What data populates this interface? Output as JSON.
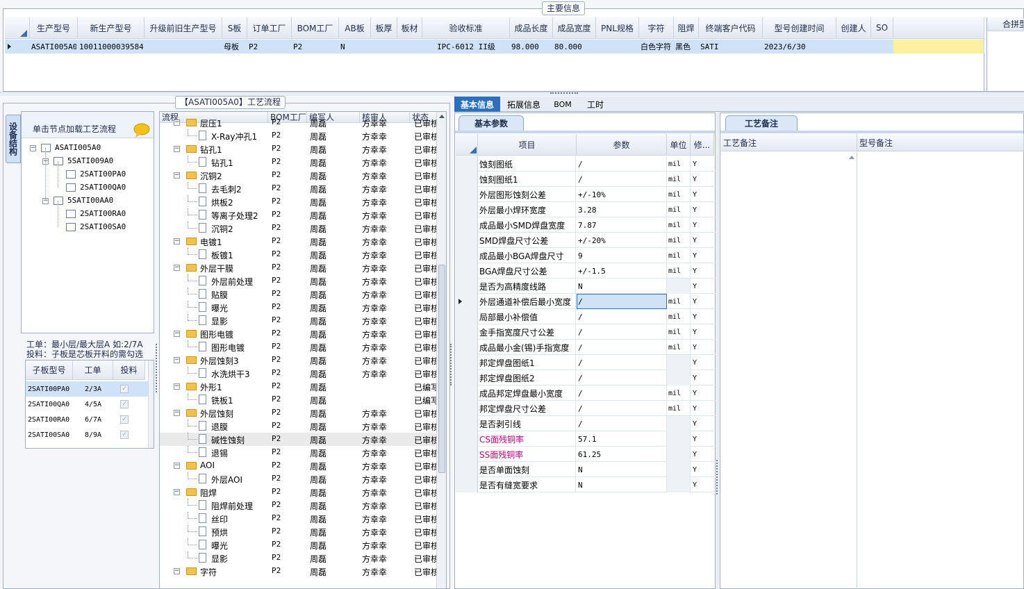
{
  "top": {
    "group_title": "主要信息",
    "columns": [
      "生产型号",
      "新生产型号",
      "升级前旧生产型号",
      "S板",
      "订单工厂",
      "BOM工厂",
      "AB板",
      "板厚",
      "板材",
      "验收标准",
      "成品长度",
      "成品宽度",
      "PNL规格",
      "字符",
      "阻焊",
      "终端客户代码",
      "型号创建时间",
      "创建人",
      "SO"
    ],
    "row": [
      "ASATI005A0",
      "10011000039584",
      "",
      "母板",
      "P2",
      "P2",
      "N",
      "",
      "",
      "IPC-6012 II级",
      "98.000",
      "80.000",
      "",
      "白色字符",
      "黑色",
      "SATI",
      "2023/6/30",
      "",
      ""
    ],
    "right_label": "合拼型"
  },
  "process": {
    "group_title": "【ASATI005A0】工艺流程",
    "side_tab": "设备结构",
    "load_hint": "单击节点加载工艺流程",
    "tree": [
      {
        "label": "ASATI005A0",
        "level": 0
      },
      {
        "label": "5SATI009A0",
        "level": 1
      },
      {
        "label": "2SATI00PA0",
        "level": 2
      },
      {
        "label": "2SATI00QA0",
        "level": 2
      },
      {
        "label": "5SATI00AA0",
        "level": 1
      },
      {
        "label": "2SATI00RA0",
        "level": 2
      },
      {
        "label": "2SATI00SA0",
        "level": 2
      }
    ],
    "note_line1": "工单：最小层/最大层A 如:2/7A",
    "note_line2": "投料：子板是芯板开料的需勾选",
    "sub_headers": [
      "子板型号",
      "工单",
      "投料"
    ],
    "sub_rows": [
      {
        "model": "2SATI00PA0",
        "order": "2/3A"
      },
      {
        "model": "2SATI00QA0",
        "order": "4/5A"
      },
      {
        "model": "2SATI00RA0",
        "order": "6/7A"
      },
      {
        "model": "2SATI00SA0",
        "order": "8/9A"
      }
    ],
    "flow_headers": [
      "流程",
      "BOM工厂",
      "编写人",
      "核审人",
      "状态"
    ],
    "flow_rows": [
      {
        "name": "层压1",
        "level": 0,
        "factory": "P2",
        "writer": "周磊",
        "reviewer": "方幸幸",
        "status": "已审核"
      },
      {
        "name": "X-Ray冲孔1",
        "level": 1,
        "factory": "P2",
        "writer": "周磊",
        "reviewer": "方幸幸",
        "status": "已审核"
      },
      {
        "name": "钻孔1",
        "level": 0,
        "factory": "P2",
        "writer": "周磊",
        "reviewer": "方幸幸",
        "status": "已审核"
      },
      {
        "name": "钻孔1",
        "level": 1,
        "factory": "P2",
        "writer": "周磊",
        "reviewer": "方幸幸",
        "status": "已审核"
      },
      {
        "name": "沉铜2",
        "level": 0,
        "factory": "P2",
        "writer": "周磊",
        "reviewer": "方幸幸",
        "status": "已审核"
      },
      {
        "name": "去毛刺2",
        "level": 1,
        "factory": "P2",
        "writer": "周磊",
        "reviewer": "方幸幸",
        "status": "已审核"
      },
      {
        "name": "烘板2",
        "level": 1,
        "factory": "P2",
        "writer": "周磊",
        "reviewer": "方幸幸",
        "status": "已审核"
      },
      {
        "name": "等离子处理2",
        "level": 1,
        "factory": "P2",
        "writer": "周磊",
        "reviewer": "方幸幸",
        "status": "已审核"
      },
      {
        "name": "沉铜2",
        "level": 1,
        "factory": "P2",
        "writer": "周磊",
        "reviewer": "方幸幸",
        "status": "已审核"
      },
      {
        "name": "电镀1",
        "level": 0,
        "factory": "P2",
        "writer": "周磊",
        "reviewer": "方幸幸",
        "status": "已审核"
      },
      {
        "name": "板镀1",
        "level": 1,
        "factory": "P2",
        "writer": "周磊",
        "reviewer": "方幸幸",
        "status": "已审核"
      },
      {
        "name": "外层干膜",
        "level": 0,
        "factory": "P2",
        "writer": "周磊",
        "reviewer": "方幸幸",
        "status": "已审核"
      },
      {
        "name": "外层前处理",
        "level": 1,
        "factory": "P2",
        "writer": "周磊",
        "reviewer": "方幸幸",
        "status": "已审核"
      },
      {
        "name": "贴膜",
        "level": 1,
        "factory": "P2",
        "writer": "周磊",
        "reviewer": "方幸幸",
        "status": "已审核"
      },
      {
        "name": "曝光",
        "level": 1,
        "factory": "P2",
        "writer": "周磊",
        "reviewer": "方幸幸",
        "status": "已审核"
      },
      {
        "name": "显影",
        "level": 1,
        "factory": "P2",
        "writer": "周磊",
        "reviewer": "方幸幸",
        "status": "已审核"
      },
      {
        "name": "图形电镀",
        "level": 0,
        "factory": "P2",
        "writer": "周磊",
        "reviewer": "方幸幸",
        "status": "已审核"
      },
      {
        "name": "图形电镀",
        "level": 1,
        "factory": "P2",
        "writer": "周磊",
        "reviewer": "方幸幸",
        "status": "已审核"
      },
      {
        "name": "外层蚀刻3",
        "level": 0,
        "factory": "P2",
        "writer": "周磊",
        "reviewer": "方幸幸",
        "status": "已审核"
      },
      {
        "name": "水洗烘干3",
        "level": 1,
        "factory": "P2",
        "writer": "周磊",
        "reviewer": "方幸幸",
        "status": "已审核"
      },
      {
        "name": "外形1",
        "level": 0,
        "factory": "P2",
        "writer": "周磊",
        "reviewer": "",
        "status": "已编写"
      },
      {
        "name": "铣板1",
        "level": 1,
        "factory": "P2",
        "writer": "周磊",
        "reviewer": "",
        "status": "已编写"
      },
      {
        "name": "外层蚀刻",
        "level": 0,
        "factory": "P2",
        "writer": "周磊",
        "reviewer": "方幸幸",
        "status": "已审核"
      },
      {
        "name": "退膜",
        "level": 1,
        "factory": "P2",
        "writer": "周磊",
        "reviewer": "方幸幸",
        "status": "已审核"
      },
      {
        "name": "碱性蚀刻",
        "level": 1,
        "factory": "P2",
        "writer": "周磊",
        "reviewer": "方幸幸",
        "status": "已审核"
      },
      {
        "name": "退锡",
        "level": 1,
        "factory": "P2",
        "writer": "周磊",
        "reviewer": "方幸幸",
        "status": "已审核"
      },
      {
        "name": "AOI",
        "level": 0,
        "factory": "P2",
        "writer": "周磊",
        "reviewer": "方幸幸",
        "status": "已审核"
      },
      {
        "name": "外层AOI",
        "level": 1,
        "factory": "P2",
        "writer": "周磊",
        "reviewer": "方幸幸",
        "status": "已审核"
      },
      {
        "name": "阻焊",
        "level": 0,
        "factory": "P2",
        "writer": "周磊",
        "reviewer": "方幸幸",
        "status": "已审核"
      },
      {
        "name": "阻焊前处理",
        "level": 1,
        "factory": "P2",
        "writer": "周磊",
        "reviewer": "方幸幸",
        "status": "已审核"
      },
      {
        "name": "丝印",
        "level": 1,
        "factory": "P2",
        "writer": "周磊",
        "reviewer": "方幸幸",
        "status": "已审核"
      },
      {
        "name": "预烘",
        "level": 1,
        "factory": "P2",
        "writer": "周磊",
        "reviewer": "方幸幸",
        "status": "已审核"
      },
      {
        "name": "曝光",
        "level": 1,
        "factory": "P2",
        "writer": "周磊",
        "reviewer": "方幸幸",
        "status": "已审核"
      },
      {
        "name": "显影",
        "level": 1,
        "factory": "P2",
        "writer": "周磊",
        "reviewer": "方幸幸",
        "status": "已审核"
      },
      {
        "name": "字符",
        "level": 0,
        "factory": "P2",
        "writer": "周磊",
        "reviewer": "方幸幸",
        "status": "已审核"
      }
    ]
  },
  "detail": {
    "tabs": [
      "基本信息",
      "拓展信息",
      "BOM",
      "工时"
    ],
    "subtab": "基本参数",
    "param_headers": [
      "项目",
      "参数",
      "单位",
      "修..."
    ],
    "params": [
      {
        "item": "蚀刻图纸",
        "value": "/",
        "unit": "mil",
        "mod": "Y"
      },
      {
        "item": "蚀刻图纸1",
        "value": "/",
        "unit": "mil",
        "mod": "Y"
      },
      {
        "item": "外层图形蚀刻公差",
        "value": "+/-10%",
        "unit": "mil",
        "mod": "Y"
      },
      {
        "item": "外层最小焊环宽度",
        "value": "3.28",
        "unit": "mil",
        "mod": "Y"
      },
      {
        "item": "成品最小SMD焊盘宽度",
        "value": "7.87",
        "unit": "mil",
        "mod": "Y"
      },
      {
        "item": "SMD焊盘尺寸公差",
        "value": "+/-20%",
        "unit": "mil",
        "mod": "Y"
      },
      {
        "item": "成品最小BGA焊盘尺寸",
        "value": "9",
        "unit": "mil",
        "mod": "Y"
      },
      {
        "item": "BGA焊盘尺寸公差",
        "value": "+/-1.5",
        "unit": "mil",
        "mod": "Y"
      },
      {
        "item": "是否为高精度线路",
        "value": "N",
        "unit": "",
        "mod": "Y"
      },
      {
        "item": "外层通道补偿后最小宽度",
        "value": "/",
        "unit": "mil",
        "mod": "Y"
      },
      {
        "item": "局部最小补偿值",
        "value": "/",
        "unit": "mil",
        "mod": "Y"
      },
      {
        "item": "金手指宽度尺寸公差",
        "value": "/",
        "unit": "mil",
        "mod": "Y"
      },
      {
        "item": "成品最小金(锡)手指宽度",
        "value": "/",
        "unit": "mil",
        "mod": "Y"
      },
      {
        "item": "邦定焊盘图纸1",
        "value": "/",
        "unit": "",
        "mod": "Y"
      },
      {
        "item": "邦定焊盘图纸2",
        "value": "/",
        "unit": "",
        "mod": "Y"
      },
      {
        "item": "成品邦定焊盘最小宽度",
        "value": "/",
        "unit": "mil",
        "mod": "Y"
      },
      {
        "item": "邦定焊盘尺寸公差",
        "value": "/",
        "unit": "mil",
        "mod": "Y"
      },
      {
        "item": "是否剥引线",
        "value": "/",
        "unit": "",
        "mod": "Y"
      },
      {
        "item": "CS面残铜率",
        "value": "57.1",
        "unit": "",
        "mod": "Y"
      },
      {
        "item": "SS面残铜率",
        "value": "61.25",
        "unit": "",
        "mod": "Y"
      },
      {
        "item": "是否单面蚀刻",
        "value": "N",
        "unit": "",
        "mod": "Y"
      },
      {
        "item": "是否有缝宽要求",
        "value": "N",
        "unit": "",
        "mod": "Y"
      }
    ],
    "remarks_tab": "工艺备注",
    "remarks_headers": [
      "工艺备注",
      "型号备注"
    ]
  },
  "colors": {
    "selection": "#cfe2f8",
    "accent": "#2c6fba",
    "magenta": "#c0007a",
    "highlight_yellow": "#fff0a0"
  }
}
